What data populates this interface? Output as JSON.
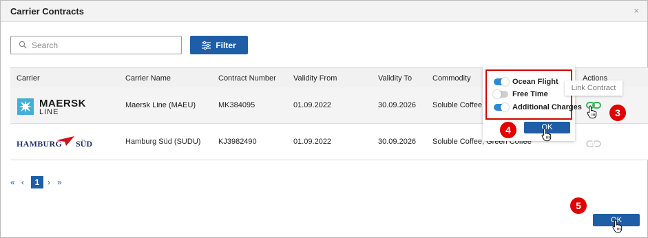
{
  "dialog": {
    "title": "Carrier Contracts",
    "close_glyph": "×"
  },
  "search": {
    "placeholder": "Search",
    "value": ""
  },
  "filter": {
    "label": "Filter"
  },
  "table": {
    "headers": [
      "Carrier",
      "Carrier Name",
      "Contract Number",
      "Validity From",
      "Validity To",
      "Commodity",
      "Actions"
    ],
    "rows": [
      {
        "logo_line1": "MAERSK",
        "logo_line2": "LINE",
        "carrier_name": "Maersk Line (MAEU)",
        "contract_number": "MK384095",
        "validity_from": "01.09.2022",
        "validity_to": "30.09.2026",
        "commodity": "Soluble Coffee, G"
      },
      {
        "logo_line1": "HAMBURG",
        "logo_line2": "SÜD",
        "carrier_name": "Hamburg Süd (SUDU)",
        "contract_number": "KJ3982490",
        "validity_from": "01.09.2022",
        "validity_to": "30.09.2026",
        "commodity": "Soluble Coffee, Green Coffee"
      }
    ]
  },
  "popover": {
    "options": [
      {
        "label": "Ocean Flight",
        "state": "on"
      },
      {
        "label": "Free Time",
        "state": "off"
      },
      {
        "label": "Additional Charges",
        "state": "on"
      }
    ],
    "ok_label": "OK"
  },
  "tooltip": {
    "text": "Link Contract"
  },
  "pagination": {
    "first": "«",
    "prev": "‹",
    "current": "1",
    "next": "›",
    "last": "»"
  },
  "footer": {
    "ok_label": "OK"
  },
  "badges": {
    "step3": "3",
    "step4": "4",
    "step5": "5"
  },
  "colors": {
    "primary": "#1f5ea6",
    "toggle_on": "#2d8ad6",
    "link_active": "#3fb35a",
    "highlight": "#d60000",
    "badge": "#e00000",
    "maersk_blue": "#42b0d5"
  },
  "icons": {
    "search": "search-icon",
    "filter": "sliders-icon",
    "link": "link-icon",
    "cursor": "hand-pointer-icon",
    "close": "close-icon"
  }
}
